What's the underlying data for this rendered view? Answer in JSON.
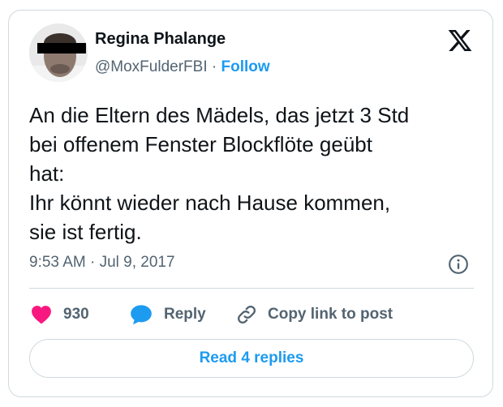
{
  "author": {
    "name": "Regina Phalange",
    "handle": "@MoxFulderFBI",
    "separator": "·",
    "follow_label": "Follow"
  },
  "tweet": {
    "text": "An die Eltern des Mädels, das jetzt 3 Std\nbei offenem Fenster Blockflöte geübt\nhat:\nIhr könnt wieder nach Hause kommen,\nsie ist fertig.",
    "timestamp": "9:53 AM · Jul 9, 2017"
  },
  "actions": {
    "like_count": "930",
    "reply_label": "Reply",
    "copy_link_label": "Copy link to post"
  },
  "read_replies_label": "Read 4 replies",
  "colors": {
    "accent": "#1d9bf0",
    "like": "#f91880",
    "text": "#0f1419",
    "muted": "#536471",
    "border": "#cfd9de"
  },
  "icons": {
    "logo": "x-logo-icon",
    "info": "info-icon",
    "like": "heart-icon",
    "reply": "speech-bubble-icon",
    "copy": "link-icon"
  }
}
